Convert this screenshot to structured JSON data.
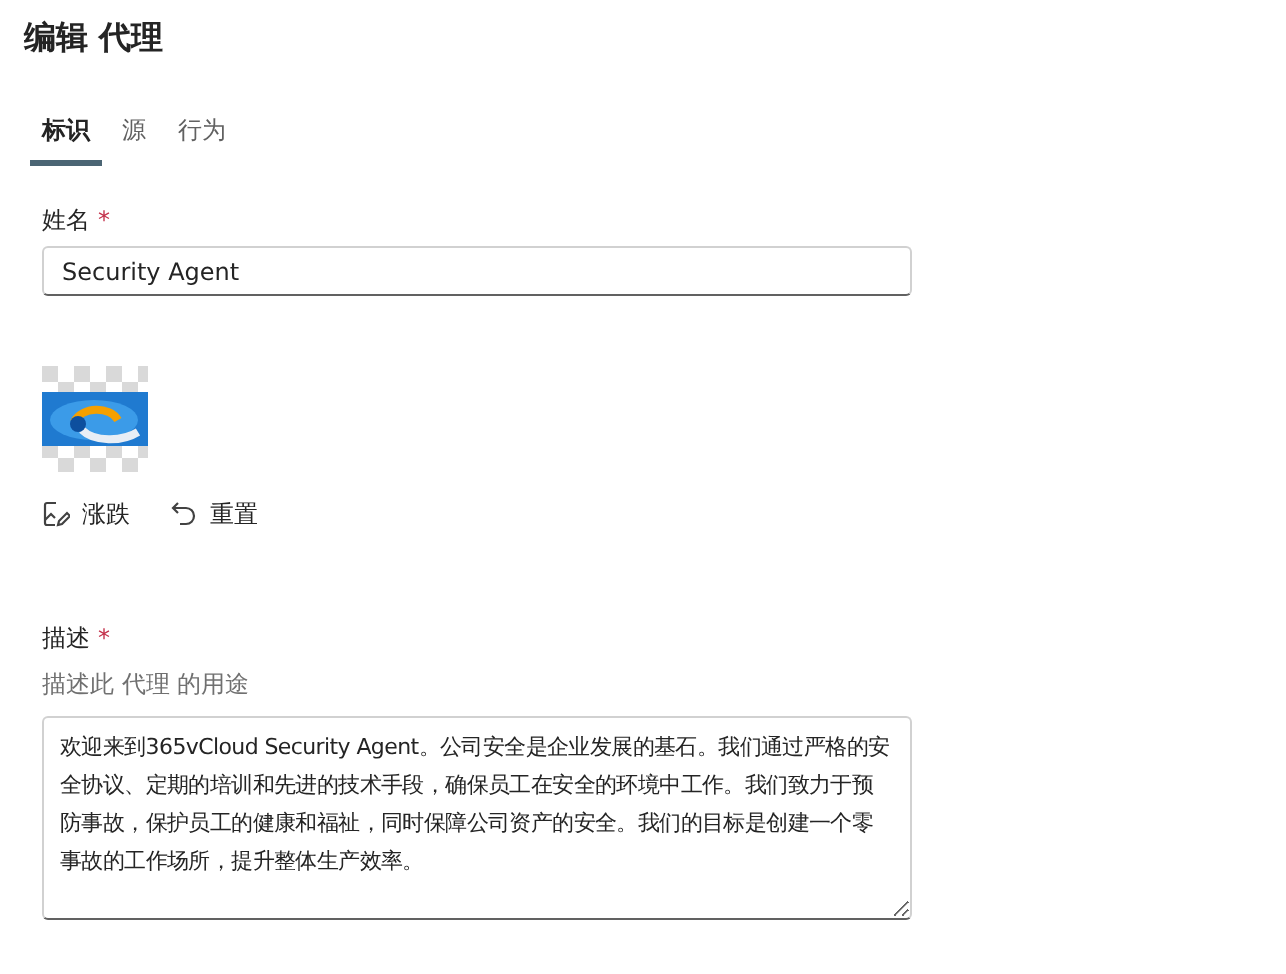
{
  "title": "编辑 代理",
  "tabs": [
    {
      "label": "标识",
      "selected": true
    },
    {
      "label": "源",
      "selected": false
    },
    {
      "label": "行为",
      "selected": false
    }
  ],
  "name_field": {
    "label": "姓名",
    "required_mark": "*",
    "value": "Security Agent"
  },
  "icon_actions": [
    {
      "kind": "edit",
      "label": "涨跌"
    },
    {
      "kind": "reset",
      "label": "重置"
    }
  ],
  "description_field": {
    "label": "描述",
    "required_mark": "*",
    "hint": "描述此 代理 的用途",
    "value": "欢迎来到365vCloud Security Agent。公司安全是企业发展的基石。我们通过严格的安全协议、定期的培训和先进的技术手段，确保员工在安全的环境中工作。我们致力于预防事故，保护员工的健康和福祉，同时保障公司资产的安全。我们的目标是创建一个零事故的工作场所，提升整体生产效率。"
  }
}
